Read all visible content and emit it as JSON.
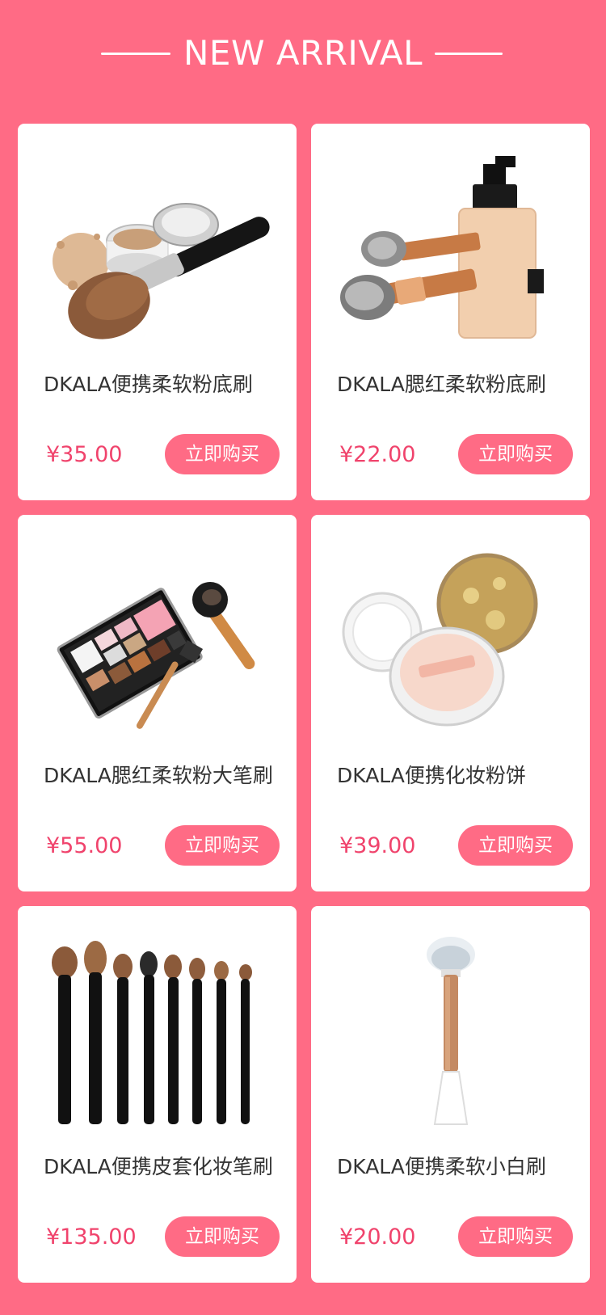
{
  "header": {
    "title": "NEW ARRIVAL"
  },
  "colors": {
    "background": "#ff6b85",
    "card": "#ffffff",
    "price": "#f0436c",
    "button": "#ff6b85",
    "text": "#333333"
  },
  "products": [
    {
      "name": "DKALA便携柔软粉底刷",
      "price": "¥35.00",
      "button_label": "立即购买",
      "image_icon": "loose-powder-brush-image"
    },
    {
      "name": "DKALA腮红柔软粉底刷",
      "price": "¥22.00",
      "button_label": "立即购买",
      "image_icon": "foundation-bottle-brushes-image"
    },
    {
      "name": "DKALA腮红柔软粉大笔刷",
      "price": "¥55.00",
      "button_label": "立即购买",
      "image_icon": "eyeshadow-palette-brushes-image"
    },
    {
      "name": "DKALA便携化妆粉饼",
      "price": "¥39.00",
      "button_label": "立即购买",
      "image_icon": "cushion-compact-image"
    },
    {
      "name": "DKALA便携皮套化妆笔刷",
      "price": "¥135.00",
      "button_label": "立即购买",
      "image_icon": "brush-set-image"
    },
    {
      "name": "DKALA便携柔软小白刷",
      "price": "¥20.00",
      "button_label": "立即购买",
      "image_icon": "single-white-brush-image"
    }
  ]
}
